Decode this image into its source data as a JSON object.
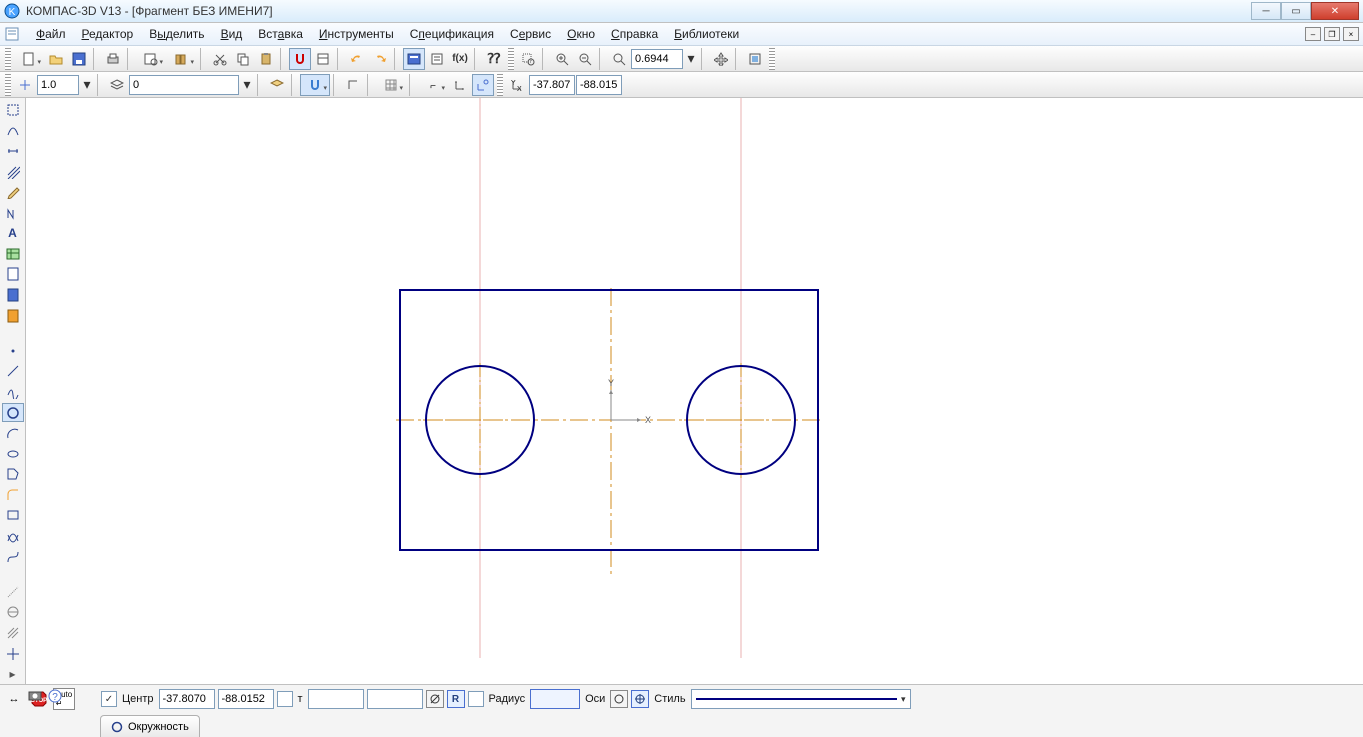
{
  "title": "КОМПАС-3D V13 - [Фрагмент БЕЗ ИМЕНИ7]",
  "menu": {
    "file": "Файл",
    "editor": "Редактор",
    "select": "Выделить",
    "view": "Вид",
    "insert": "Вставка",
    "tools": "Инструменты",
    "spec": "Спецификация",
    "service": "Сервис",
    "window": "Окно",
    "help": "Справка",
    "libs": "Библиотеки"
  },
  "toolbar": {
    "zoom_value": "0.6944",
    "scale_value": "1.0",
    "layer_value": "0",
    "coord_x": "-37.807",
    "coord_y": "-88.015"
  },
  "props": {
    "center_label": "Центр",
    "center_x": "-37.8070",
    "center_y": "-88.0152",
    "t_label": "т",
    "radius_label": "Радиус",
    "radius_value": "",
    "axes_label": "Оси",
    "style_label": "Стиль",
    "r_btn": "R"
  },
  "tab": {
    "name": "Окружность"
  },
  "axis_labels": {
    "x": "X",
    "y": "Y"
  },
  "colors": {
    "drawing_blue": "#000080",
    "axis_orange": "#d28b1e",
    "guide_pink": "#e8b0b0"
  }
}
